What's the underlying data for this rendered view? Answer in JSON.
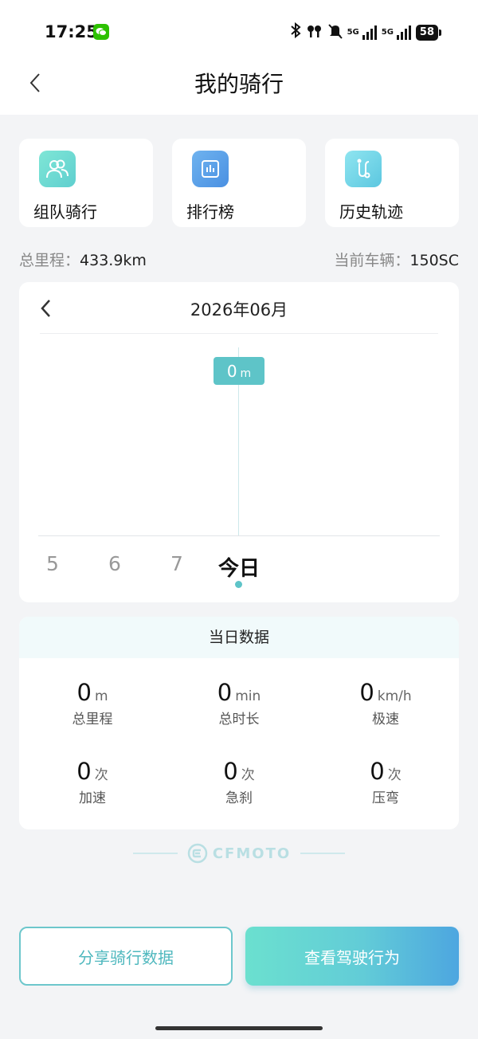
{
  "status_bar": {
    "time": "17:25",
    "net1": "5G",
    "net2": "5G",
    "battery": "58"
  },
  "header": {
    "title": "我的骑行"
  },
  "features": [
    {
      "label": "组队骑行",
      "icon": "team-riders-icon"
    },
    {
      "label": "排行榜",
      "icon": "ranking-chart-icon"
    },
    {
      "label": "历史轨迹",
      "icon": "route-track-icon"
    }
  ],
  "summary": {
    "total_label": "总里程：",
    "total_value": "433.9km",
    "vehicle_label": "当前车辆：",
    "vehicle_value": "150SC"
  },
  "chart": {
    "month": "2026年06月",
    "tooltip_value": "0",
    "tooltip_unit": "m",
    "days": [
      "5",
      "6",
      "7",
      "今日"
    ],
    "selected_day": "今日"
  },
  "chart_data": {
    "type": "bar",
    "categories": [
      "5",
      "6",
      "7",
      "今日"
    ],
    "values": [
      0,
      0,
      0,
      0
    ],
    "title": "2026年06月"
  },
  "daily": {
    "title": "当日数据",
    "stats": [
      {
        "value": "0",
        "unit": "m",
        "label": "总里程"
      },
      {
        "value": "0",
        "unit": "min",
        "label": "总时长"
      },
      {
        "value": "0",
        "unit": "km/h",
        "label": "极速"
      },
      {
        "value": "0",
        "unit": "次",
        "label": "加速"
      },
      {
        "value": "0",
        "unit": "次",
        "label": "急刹"
      },
      {
        "value": "0",
        "unit": "次",
        "label": "压弯"
      }
    ]
  },
  "logo": {
    "text": "CFMOTO"
  },
  "buttons": {
    "share": "分享骑行数据",
    "drive": "查看驾驶行为"
  },
  "colors": {
    "accent": "#5ec4c8",
    "gradient_end": "#4da6e0"
  }
}
